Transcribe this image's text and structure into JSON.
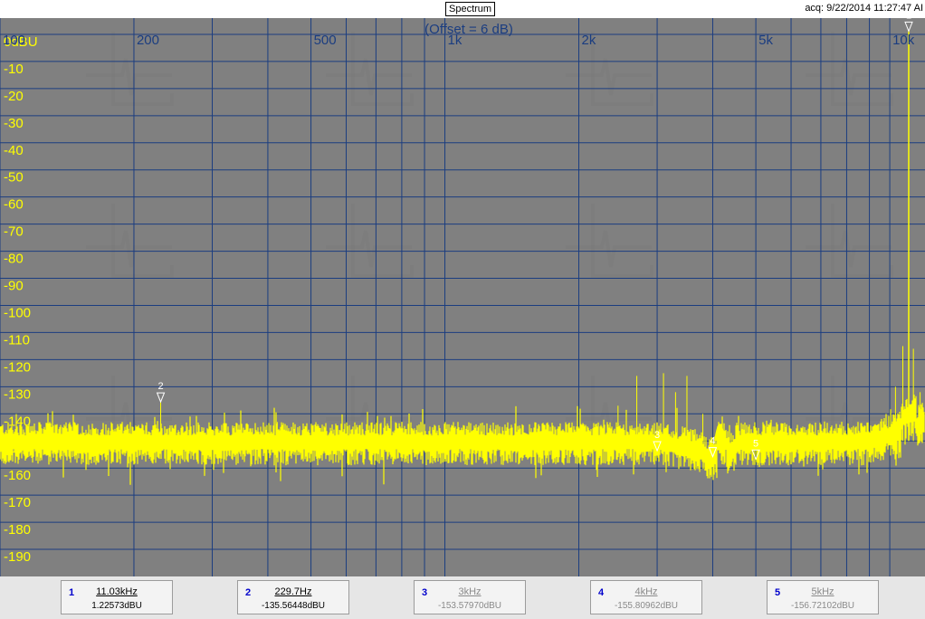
{
  "window": {
    "title": "Spectrum",
    "acquisition": "acq: 9/22/2014 11:27:47 AI"
  },
  "chart_data": {
    "type": "line",
    "x_scale": "log",
    "xlim": [
      100,
      12000
    ],
    "ylim": [
      -200,
      6
    ],
    "x_ticks": [
      {
        "value": 100,
        "label": "100"
      },
      {
        "value": 200,
        "label": "200"
      },
      {
        "value": 500,
        "label": "500"
      },
      {
        "value": 1000,
        "label": "1k"
      },
      {
        "value": 2000,
        "label": "2k"
      },
      {
        "value": 5000,
        "label": "5k"
      },
      {
        "value": 10000,
        "label": "10k"
      }
    ],
    "y_ticks": [
      {
        "value": 0,
        "label": "0dBU"
      },
      {
        "value": -10,
        "label": "-10"
      },
      {
        "value": -20,
        "label": "-20"
      },
      {
        "value": -30,
        "label": "-30"
      },
      {
        "value": -40,
        "label": "-40"
      },
      {
        "value": -50,
        "label": "-50"
      },
      {
        "value": -60,
        "label": "-60"
      },
      {
        "value": -70,
        "label": "-70"
      },
      {
        "value": -80,
        "label": "-80"
      },
      {
        "value": -90,
        "label": "-90"
      },
      {
        "value": -100,
        "label": "-100"
      },
      {
        "value": -110,
        "label": "-110"
      },
      {
        "value": -120,
        "label": "-120"
      },
      {
        "value": -130,
        "label": "-130"
      },
      {
        "value": -140,
        "label": "-140"
      },
      {
        "value": -150,
        "label": "-150"
      },
      {
        "value": -160,
        "label": "-160"
      },
      {
        "value": -170,
        "label": "-170"
      },
      {
        "value": -180,
        "label": "-180"
      },
      {
        "value": -190,
        "label": "-190"
      }
    ],
    "annotation": "(Offset = 6 dB)",
    "grid": true,
    "colors": {
      "trace": "#ffff00",
      "background": "#808080",
      "grid": "#1b3d80",
      "y_labels": "#ffff00",
      "x_labels": "#1b3d80"
    },
    "noise_floor_db": -150,
    "spurs": [
      {
        "x": 229.7,
        "y": -135.6
      },
      {
        "x": 420,
        "y": -143
      },
      {
        "x": 2450,
        "y": -137
      },
      {
        "x": 2700,
        "y": -126
      },
      {
        "x": 3100,
        "y": -125
      },
      {
        "x": 3300,
        "y": -132
      },
      {
        "x": 3500,
        "y": -126
      },
      {
        "x": 3800,
        "y": -140
      },
      {
        "x": 4200,
        "y": -145
      },
      {
        "x": 10300,
        "y": -130
      },
      {
        "x": 10700,
        "y": -115
      },
      {
        "x": 11300,
        "y": -116
      },
      {
        "x": 11700,
        "y": -132
      }
    ],
    "fundamental": {
      "x": 11030,
      "y": 1.2
    },
    "markers": [
      {
        "id": "1",
        "freq": "11.03kHz",
        "amp": "1.22573dBU",
        "x": 11030,
        "y": 1.2,
        "active": true
      },
      {
        "id": "2",
        "freq": "229.7Hz",
        "amp": "-135.56448dBU",
        "x": 229.7,
        "y": -135.6,
        "active": true
      },
      {
        "id": "3",
        "freq": "3kHz",
        "amp": "-153.57970dBU",
        "x": 3000,
        "y": -153.6,
        "active": false
      },
      {
        "id": "4",
        "freq": "4kHz",
        "amp": "-155.80962dBU",
        "x": 4000,
        "y": -155.8,
        "active": false
      },
      {
        "id": "5",
        "freq": "5kHz",
        "amp": "-156.72102dBU",
        "x": 5000,
        "y": -156.7,
        "active": false
      }
    ]
  }
}
